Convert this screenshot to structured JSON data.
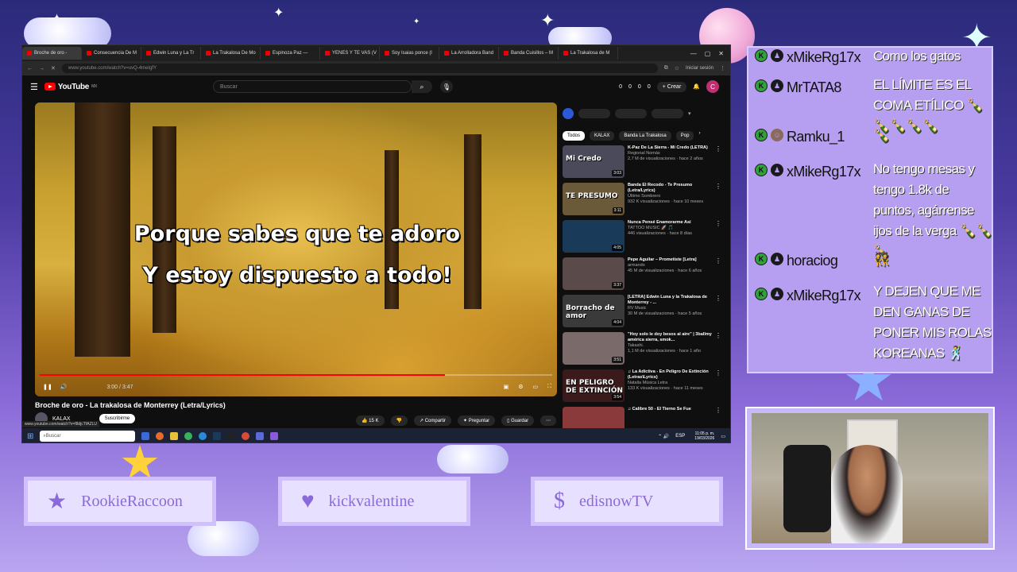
{
  "browser": {
    "tabs": [
      {
        "label": "Broche de oro -",
        "active": true
      },
      {
        "label": "Consecuencia De M"
      },
      {
        "label": "Edwin Luna y La Tr"
      },
      {
        "label": "La Trakalosa De Mo"
      },
      {
        "label": "Espinoza Paz —"
      },
      {
        "label": "YENES Y TE VAS (V"
      },
      {
        "label": "Soy Isaias ponce (l"
      },
      {
        "label": "La Arrolladora Band"
      },
      {
        "label": "Banda Cuisillos – M"
      },
      {
        "label": "La Trakalosa de M"
      }
    ],
    "url": "www.youtube.com/watch?v=uvQ-4meIgfY",
    "signin_label": "Iniciar sesión",
    "status_url": "www.youtube.com/watch?v=f8djcTfAZLU"
  },
  "youtube": {
    "logo_text": "YouTube",
    "logo_region": "MX",
    "search_placeholder": "Buscar",
    "create_label": "Crear",
    "counters": [
      "0",
      "0",
      "0",
      "0"
    ],
    "avatar_initial": "C",
    "video": {
      "lyrics_line1": "Porque sabes que te adoro",
      "lyrics_line2": "Y estoy dispuesto a todo!",
      "time": "3:00 / 3:47",
      "progress": 0.79,
      "title": "Broche de oro - La trakalosa de Monterrey (Letra/Lyrics)",
      "channel": "KALAX",
      "subscribe_label": "Suscribirme",
      "likes": "15 K",
      "share_label": "Compartir",
      "ask_label": "Preguntar",
      "save_label": "Guardar"
    },
    "chips": [
      "Todos",
      "KALAX",
      "Banda La Trakalosa",
      "Pop"
    ],
    "related": [
      {
        "title": "K-Paz De La Sierra - Mi Credo (LETRA)",
        "channel": "Regional Nomás",
        "views": "2,7 M de visualizaciones · hace 2 años",
        "duration": "3:03",
        "thumb_text": "Mi Credo",
        "color": "#4a4a5a"
      },
      {
        "title": "Banda El Recodo - Te Presumo (Letra/Lyrics)",
        "channel": "Último Sombrero",
        "views": "932 K visualizaciones · hace 10 meses",
        "duration": "3:11",
        "thumb_text": "TE PRESUMO",
        "color": "#6a5a3a"
      },
      {
        "title": "Nunca Pensé Enamorarme Así",
        "channel": "TATTOO MUSIC 🚀 🎵",
        "views": "446 visualizaciones · hace 8 días",
        "duration": "4:05",
        "thumb_text": "",
        "color": "#1a3a5a"
      },
      {
        "title": "Pepe Aguilar – Prometiste [Letra]",
        "channel": "armando",
        "views": "45 M de visualizaciones · hace 6 años",
        "duration": "3:37",
        "thumb_text": "",
        "color": "#5a4a4a"
      },
      {
        "title": "[LETRA] Edwin Luna y la Trakalosa de Monterrey - ...",
        "channel": "RV Music",
        "views": "30 M de visualizaciones · hace 5 años",
        "duration": "4:04",
        "thumb_text": "Borracho de amor",
        "color": "#3a3a3a"
      },
      {
        "title": "\"Hoy solo le doy besos al aire\" | 3ballmy américa sierra, smok...",
        "channel": "Takashi.",
        "views": "1,1 M de visualizaciones · hace 1 año",
        "duration": "3:51",
        "thumb_text": "",
        "color": "#7a6a6a"
      },
      {
        "title": "♫ La Adictiva - En Peligro De Extinción (Letras\\Lyrics)",
        "channel": "Natalia Música Letra",
        "views": "133 K visualizaciones · hace 11 meses",
        "duration": "3:54",
        "thumb_text": "EN PELIGRO DE EXTINCIÓN",
        "color": "#3a1a1a"
      },
      {
        "title": "♫ Calibre 50 - El Tierno Se Fue",
        "channel": "",
        "views": "",
        "duration": "",
        "thumb_text": "",
        "color": "#8a3a3a"
      }
    ]
  },
  "taskbar": {
    "search_placeholder": "Buscar",
    "lang": "ESP",
    "time": "11:05 p. m.",
    "date": "19/03/2026"
  },
  "chat": {
    "messages": [
      {
        "user": "xMikeRg17x",
        "text": "Como los gatos"
      },
      {
        "user": "MrTATA8",
        "text": "EL LÍMITE ES EL COMA ETÍLICO 🍾🍾🍾🍾🍾"
      },
      {
        "user": "Ramku_1",
        "text": "🍾"
      },
      {
        "user": "xMikeRg17x",
        "text": "No tengo mesas y tengo 1.8k de puntos, agárrense ijos de la verga 🍾🍾🍾"
      },
      {
        "user": "horaciog",
        "text": "👯"
      },
      {
        "user": "xMikeRg17x",
        "text": "Y DEJEN QUE ME DEN GANAS DE PONER MIS ROLAS KOREANAS 🕺"
      }
    ]
  },
  "socials": [
    {
      "name": "RookieRaccoon",
      "icon": "star-icon"
    },
    {
      "name": "kickvalentine",
      "icon": "heart-icon"
    },
    {
      "name": "edisnowTV",
      "icon": "dollar-icon"
    }
  ]
}
